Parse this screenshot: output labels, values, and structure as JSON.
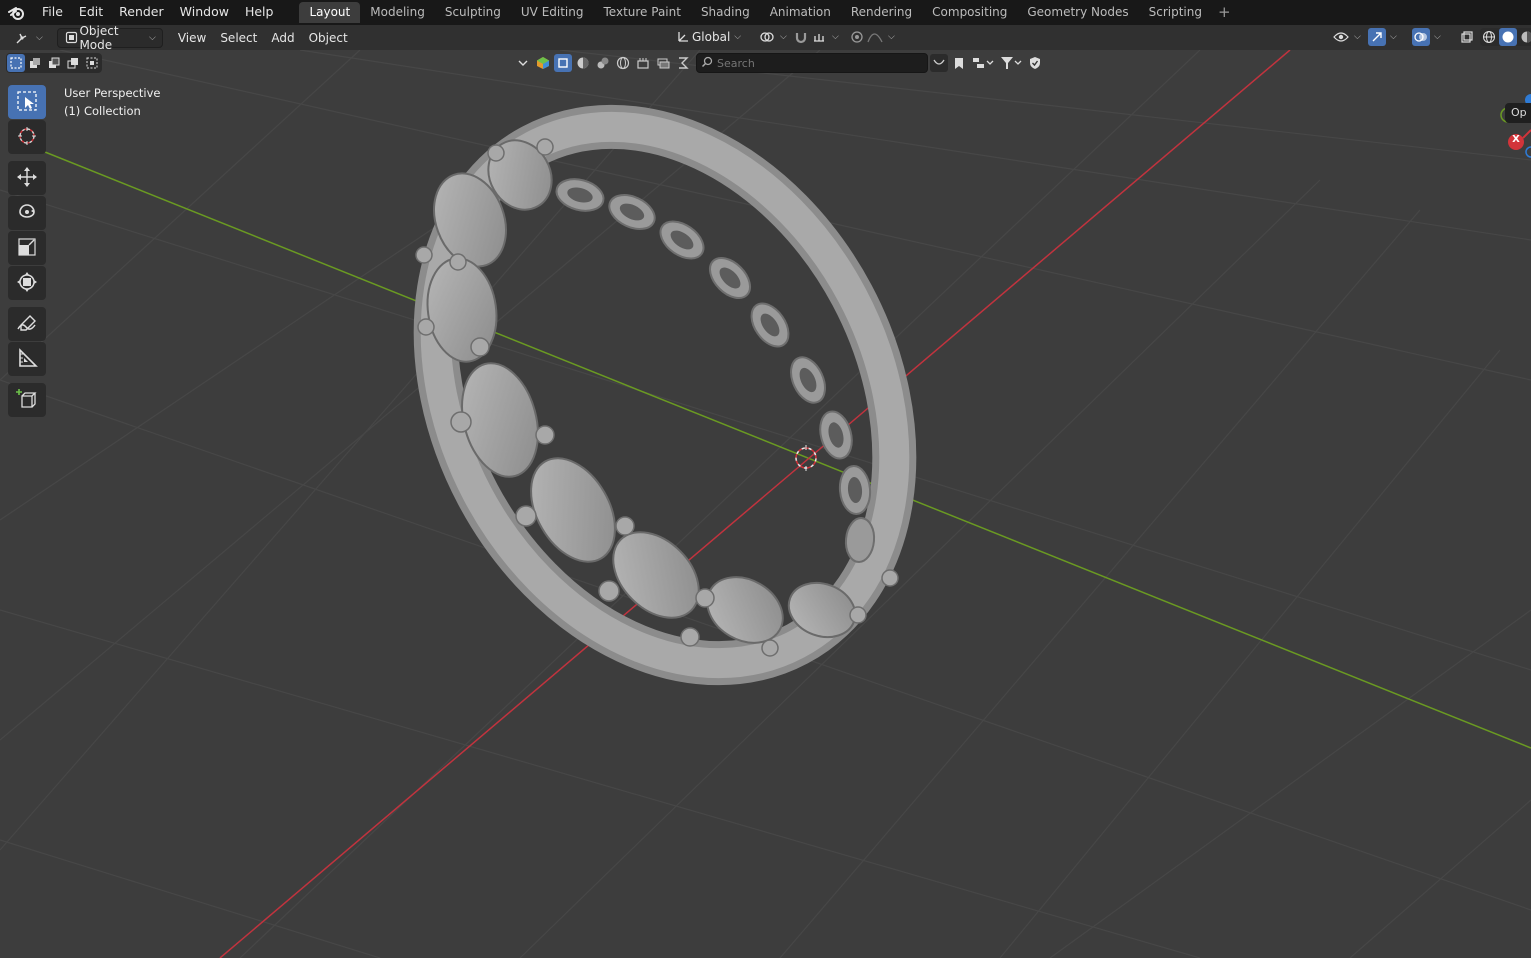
{
  "topbar": {
    "menu": [
      "File",
      "Edit",
      "Render",
      "Window",
      "Help"
    ],
    "workspaces": [
      "Layout",
      "Modeling",
      "Sculpting",
      "UV Editing",
      "Texture Paint",
      "Shading",
      "Animation",
      "Rendering",
      "Compositing",
      "Geometry Nodes",
      "Scripting"
    ],
    "active_workspace": "Layout",
    "add_tab": "+"
  },
  "header": {
    "mode": "Object Mode",
    "menus": [
      "View",
      "Select",
      "Add",
      "Object"
    ],
    "orientation": "Global"
  },
  "outliner_bar": {
    "search_placeholder": "Search"
  },
  "viewport": {
    "perspective": "User Perspective",
    "collection": "(1) Collection",
    "side_tab": "Op",
    "gizmo_x": "X"
  },
  "colors": {
    "accent": "#4772b3",
    "axis_x": "#c1333e",
    "axis_y": "#6a9a22",
    "grid": "#4a4a4a",
    "background": "#3d3d3d"
  },
  "icons": [
    "blender-logo-icon",
    "editor-type-icon",
    "select-box-icon",
    "cursor-icon",
    "move-icon",
    "rotate-icon",
    "scale-icon",
    "transform-icon",
    "annotate-icon",
    "measure-icon",
    "add-cube-icon",
    "search-icon",
    "filter-icon"
  ]
}
